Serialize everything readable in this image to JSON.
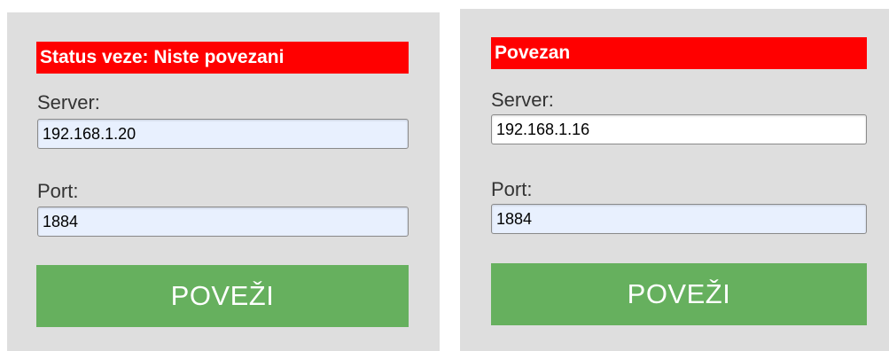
{
  "colors": {
    "panel_bg": "#dedede",
    "status_bg": "#ff0000",
    "status_text": "#ffffff",
    "button_bg": "#66b05e",
    "button_text": "#ffffff",
    "autofill_input_bg": "#e8f0fe"
  },
  "panels": [
    {
      "status_text": "Status veze: Niste povezani",
      "server_label": "Server:",
      "server_value": "192.168.1.20",
      "port_label": "Port:",
      "port_value": "1884",
      "connect_label": "POVEŽI"
    },
    {
      "status_text": "Povezan",
      "server_label": "Server:",
      "server_value": "192.168.1.16",
      "port_label": "Port:",
      "port_value": "1884",
      "connect_label": "POVEŽI"
    }
  ]
}
